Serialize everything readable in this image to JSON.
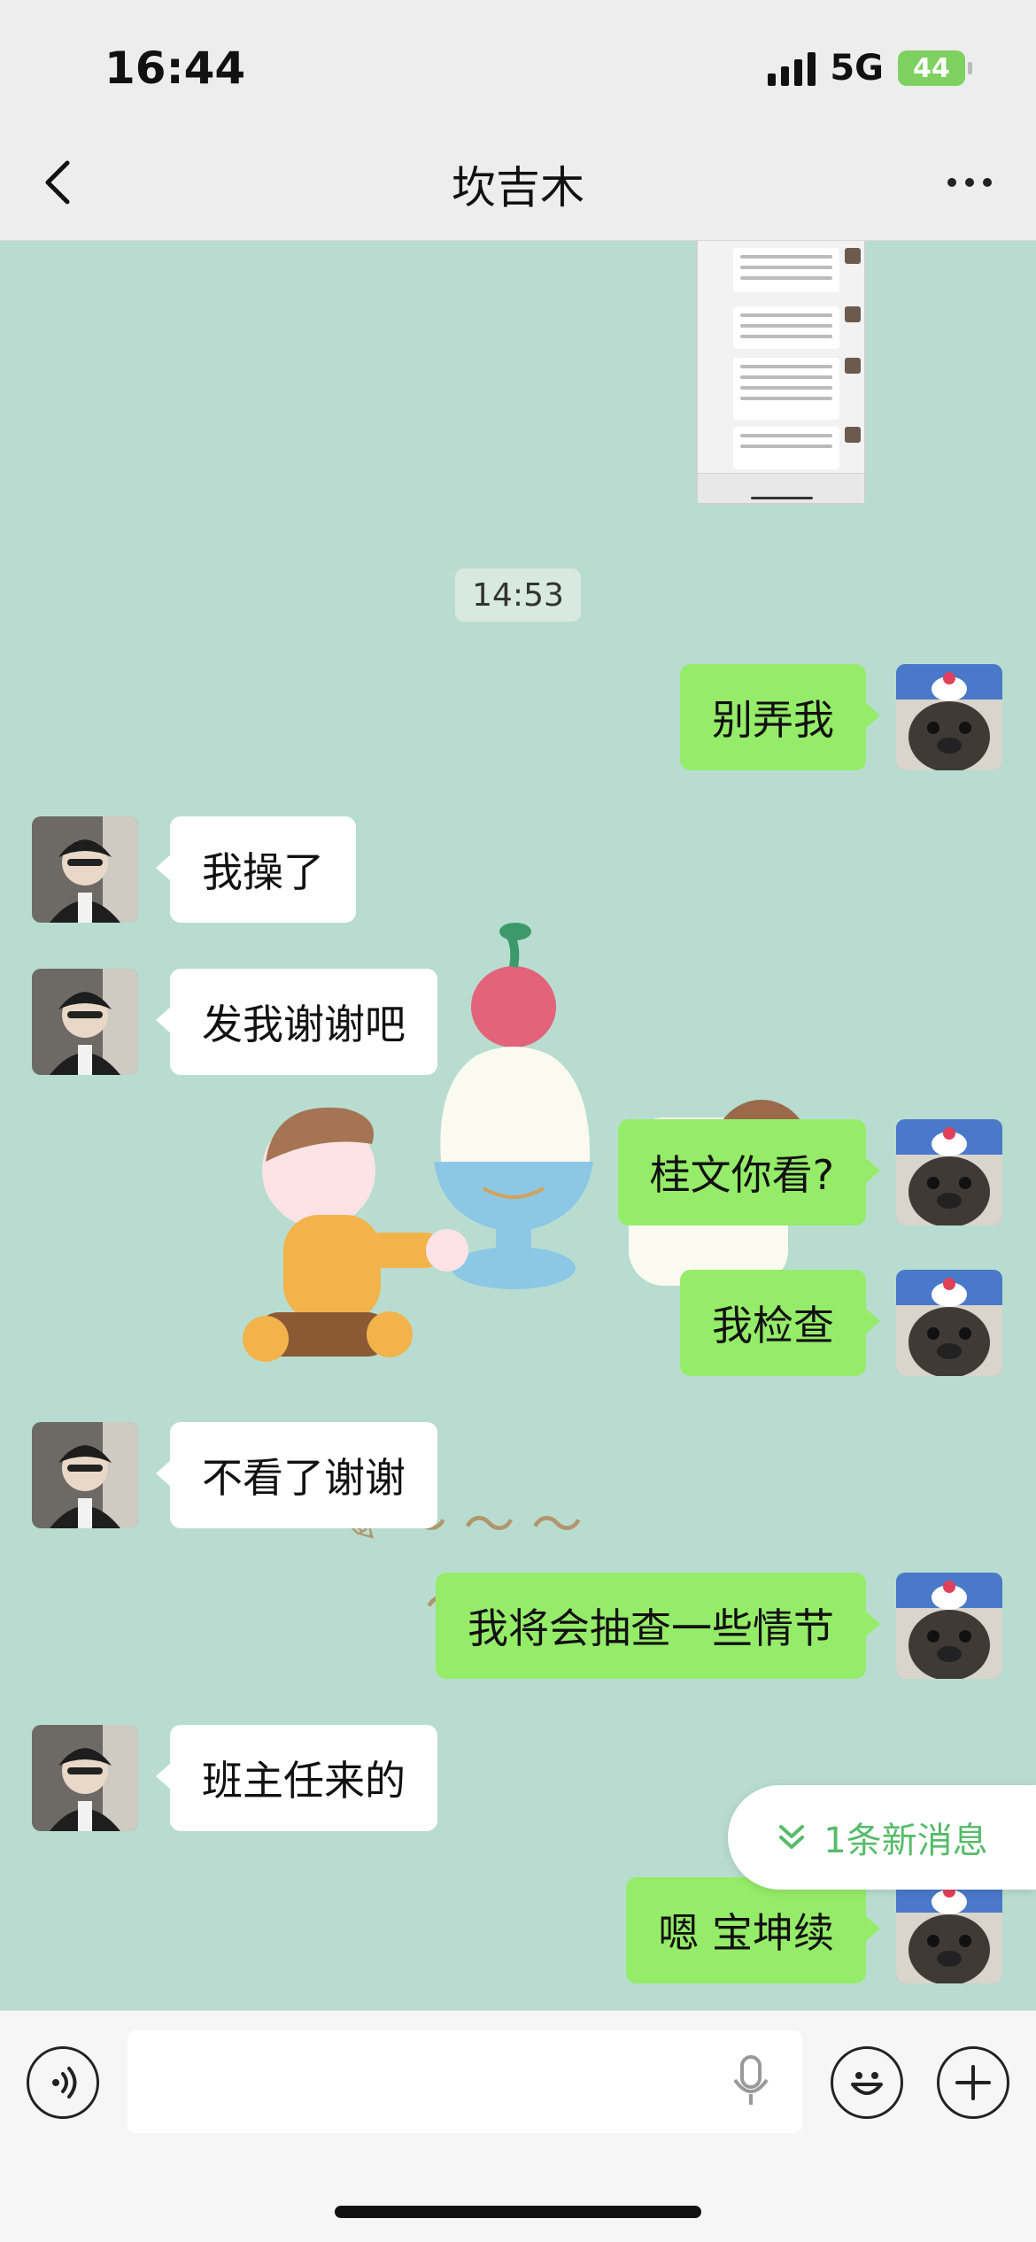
{
  "status_bar": {
    "time": "16:44",
    "network": "5G",
    "battery": "44"
  },
  "header": {
    "title": "坎吉木"
  },
  "chat": {
    "timestamp": "14:53",
    "messages": [
      {
        "side": "mine",
        "text": "别弄我"
      },
      {
        "side": "theirs",
        "text": "我操了"
      },
      {
        "side": "theirs",
        "text": "发我谢谢吧"
      },
      {
        "side": "mine",
        "text": "桂文你看?"
      },
      {
        "side": "mine",
        "text": "我检查"
      },
      {
        "side": "theirs",
        "text": "不看了谢谢"
      },
      {
        "side": "mine",
        "text": "我将会抽查一些情节"
      },
      {
        "side": "theirs",
        "text": "班主任来的"
      },
      {
        "side": "mine",
        "text": "嗯 宝坤续"
      }
    ],
    "new_message_pill": "1条新消息"
  },
  "colors": {
    "chat_background": "#b8ddd0",
    "my_bubble": "#95ec69",
    "their_bubble": "#ffffff",
    "accent_green": "#57bb6b"
  },
  "icons": [
    "back-icon",
    "more-icon",
    "voice-icon",
    "mic-icon",
    "emoji-icon",
    "plus-icon",
    "double-chevron-down-icon"
  ]
}
